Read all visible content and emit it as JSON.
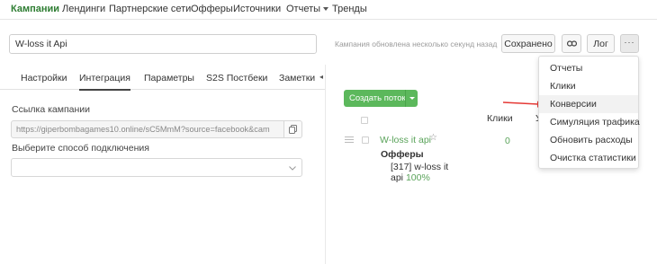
{
  "topnav": {
    "items": [
      {
        "label": "Кампании",
        "active": true
      },
      {
        "label": "Лендинги"
      },
      {
        "label": "Партнерские сети"
      },
      {
        "label": "Офферы"
      },
      {
        "label": "Источники"
      },
      {
        "label": "Отчеты"
      },
      {
        "label": "Тренды"
      }
    ]
  },
  "campaign": {
    "name": "W-loss it Api",
    "status": "Кампания обновлена несколько секунд назад",
    "saved_label": "Сохранено",
    "log_label": "Лог",
    "link_icon": "link-icon",
    "more_icon": "ellipsis-icon"
  },
  "tabs": [
    "Настройки",
    "Интеграция",
    "Параметры",
    "S2S Постбеки",
    "Заметки"
  ],
  "active_tab": "Интеграция",
  "integration": {
    "link_label": "Ссылка кампании",
    "link_value": "https://giperbombagames10.online/sC5MmM?source=facebook&cam",
    "copy_icon": "copy-icon",
    "method_label": "Выберите способ подключения",
    "method_value": ""
  },
  "flows": {
    "create_label": "Создать поток",
    "columns": {
      "clicks": "Клики",
      "next": "У"
    },
    "rows": [
      {
        "name": "W-loss it api",
        "clicks": "0",
        "offers_label": "Офферы",
        "offer_line1": "[317] w-loss it",
        "offer_line2": "api",
        "offer_pct": "100%"
      }
    ]
  },
  "dropdown": {
    "items": [
      {
        "label": "Отчеты"
      },
      {
        "label": "Клики"
      },
      {
        "label": "Конверсии",
        "highlighted": true
      },
      {
        "label": "Симуляция трафика"
      },
      {
        "label": "Обновить расходы"
      },
      {
        "label": "Очистка статистики"
      }
    ]
  },
  "colors": {
    "accent": "#2e7d32",
    "green_button": "#5cb85c",
    "link_green": "#5aa35a",
    "arrow_red": "#e53935"
  }
}
